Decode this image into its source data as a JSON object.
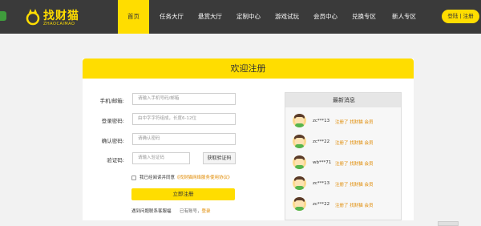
{
  "header": {
    "logo_title": "找财猫",
    "logo_sub": "ZHAOCAIMAO",
    "nav": [
      "首页",
      "任务大厅",
      "悬赏大厅",
      "定制中心",
      "游戏试玩",
      "会员中心",
      "兑换专区",
      "新人专区"
    ],
    "login_label": "登陆",
    "separator": "|",
    "register_label": "注册"
  },
  "form": {
    "title": "欢迎注册",
    "phone_label": "手机/邮箱:",
    "phone_placeholder": "请输入手机号码/邮箱",
    "password_label": "登录密码:",
    "password_placeholder": "由中字字符组成，长度6-12位",
    "confirm_label": "确认密码:",
    "confirm_placeholder": "请确认密码",
    "code_label": "验证码:",
    "code_placeholder": "请输入验证码",
    "code_button": "获取验证码",
    "agree_text": "我已经阅读并同意",
    "agree_link": "《找财猫网络服务使用协议》",
    "submit": "立即注册",
    "footer_left": "遇到问题联系客服福",
    "footer_right": "已有账号，",
    "footer_login": "登录"
  },
  "news": {
    "title": "最新消息",
    "items": [
      {
        "user": "zc***13",
        "action": "注册了 找财猫 会员"
      },
      {
        "user": "zc***22",
        "action": "注册了 找财猫 会员"
      },
      {
        "user": "wb***71",
        "action": "注册了 找财猫 会员"
      },
      {
        "user": "zc***13",
        "action": "注册了 找财猫 会员"
      },
      {
        "user": "zc***22",
        "action": "注册了 找财猫 会员"
      }
    ]
  },
  "colors": {
    "accent": "#ffdd00",
    "header_bg": "#3a3a3a",
    "link": "#e08a00"
  }
}
